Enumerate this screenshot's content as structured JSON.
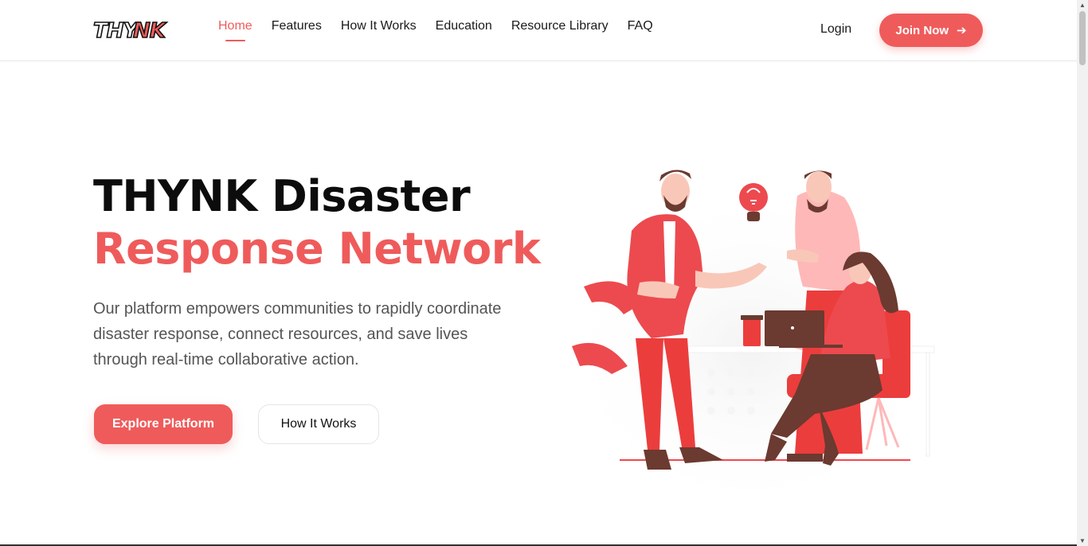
{
  "brand": {
    "logo_text": "THYNK",
    "accent_color": "#ef5b5b"
  },
  "nav": {
    "links": [
      {
        "label": "Home",
        "active": true
      },
      {
        "label": "Features",
        "active": false
      },
      {
        "label": "How It Works",
        "active": false
      },
      {
        "label": "Education",
        "active": false
      },
      {
        "label": "Resource Library",
        "active": false
      },
      {
        "label": "FAQ",
        "active": false
      }
    ],
    "login_label": "Login",
    "join_label": "Join Now",
    "join_icon": "arrow-right-icon"
  },
  "hero": {
    "title_line1": "THYNK Disaster",
    "title_line2": "Response Network",
    "description": "Our platform empowers communities to rapidly coordinate disaster response, connect resources, and save lives through real-time collaborative action.",
    "primary_button": "Explore Platform",
    "secondary_button": "How It Works",
    "illustration_icon": "team-collaboration-illustration"
  }
}
